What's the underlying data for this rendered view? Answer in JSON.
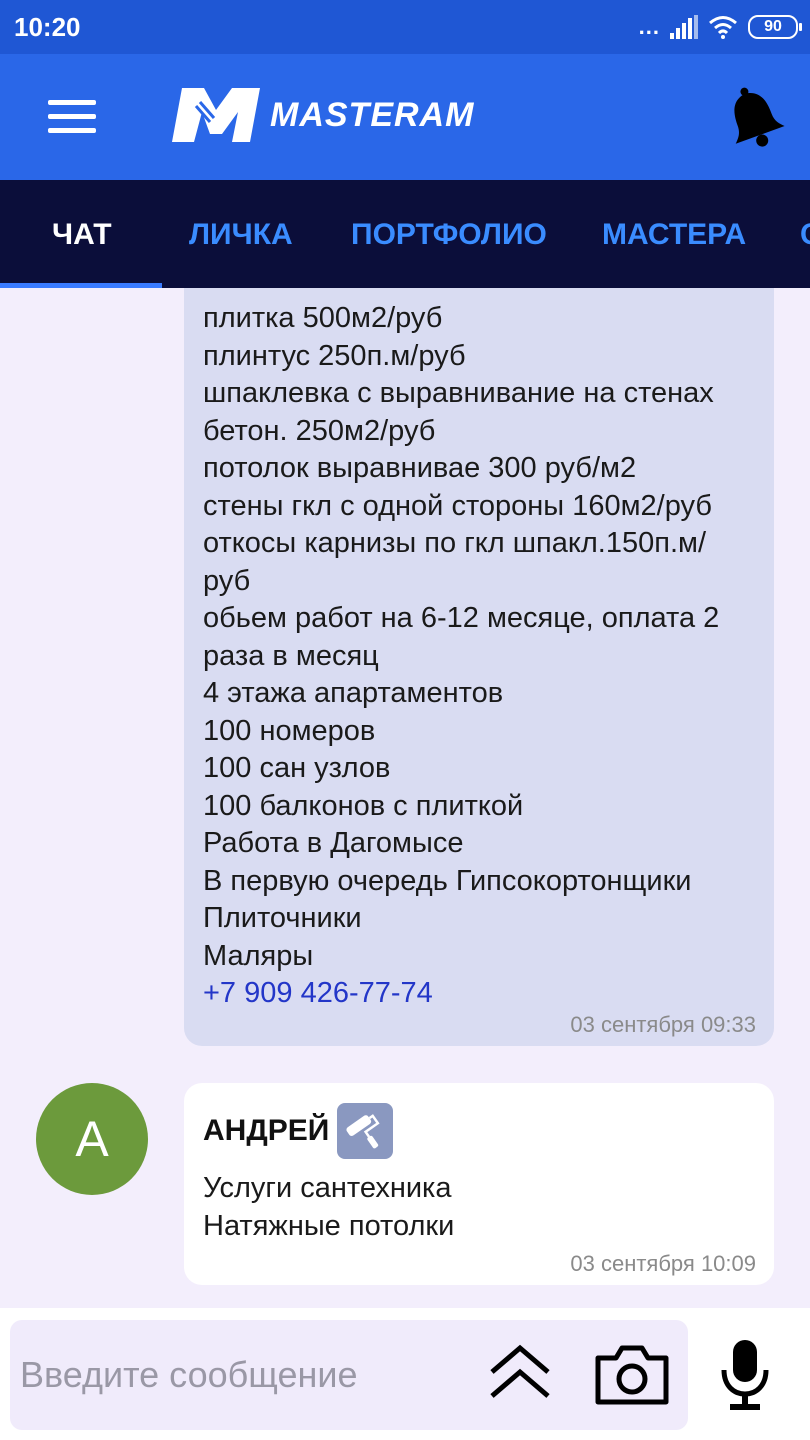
{
  "status_bar": {
    "time": "10:20",
    "signal_dots": "...",
    "battery": "90"
  },
  "app_bar": {
    "menu_icon": "hamburger-menu-icon",
    "logo_text": "MASTERAM",
    "bell_icon": "bell-icon"
  },
  "tabs": [
    {
      "label": "ЧАТ",
      "active": true
    },
    {
      "label": "ЛИЧКА",
      "active": false
    },
    {
      "label": "ПОРТФОЛИО",
      "active": false
    },
    {
      "label": "МАСТЕРА",
      "active": false
    }
  ],
  "messages": [
    {
      "lines": [
        "плитка 500м2/руб",
        "плинтус 250п.м/руб",
        "шпаклевка с выравнивание на стенах",
        "бетон. 250м2/руб",
        "потолок выравнивае 300 руб/м2",
        "стены гкл с одной стороны 160м2/руб",
        "откосы карнизы по гкл шпакл.150п.м/",
        "руб",
        "обьем работ на 6-12 месяце, оплата 2",
        "раза в месяц",
        "4 этажа апартаментов",
        "100 номеров",
        "100 сан узлов",
        "100 балконов с плиткой",
        "Работа в Дагомысе",
        "В первую очередь Гипсокортонщики",
        "Плиточники",
        "Маляры"
      ],
      "phone": "+7 909 426-77-74",
      "time": "03 сентября 09:33"
    },
    {
      "avatar_letter": "А",
      "author": "АНДРЕЙ",
      "role_icon": "paint-roller-icon",
      "lines": [
        "Услуги сантехника",
        "Натяжные потолки"
      ],
      "time": "03 сентября 10:09"
    }
  ],
  "input": {
    "placeholder": "Введите сообщение",
    "value": ""
  },
  "colors": {
    "status_bar": "#1f57d4",
    "app_bar": "#2a67e8",
    "tabs_bg": "#0b0e3a",
    "tab_inactive": "#3a8cff",
    "bubble_own": "#d9dcf2",
    "link": "#2336c8",
    "avatar": "#6c9a3c"
  }
}
